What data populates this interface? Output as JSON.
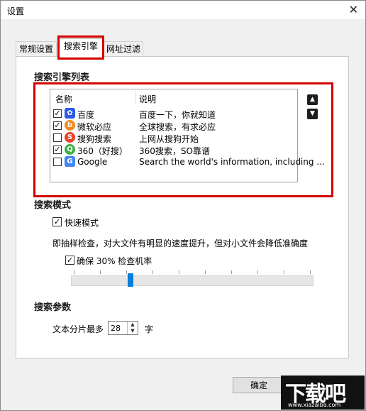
{
  "window": {
    "title": "设置",
    "close_glyph": "✕"
  },
  "tabs": [
    {
      "label": "常规设置",
      "active": false
    },
    {
      "label": "搜索引擎",
      "active": true
    },
    {
      "label": "网址过滤",
      "active": false
    }
  ],
  "engine_section": {
    "title": "搜索引擎列表",
    "columns": {
      "name": "名称",
      "desc": "说明"
    },
    "engines": [
      {
        "checked": true,
        "name": "百度",
        "desc": "百度一下，你就知道",
        "icon": "baidu-icon",
        "icon_glyph": "✿",
        "color": "#2d5be3"
      },
      {
        "checked": true,
        "name": "微软必应",
        "desc": "全球搜索，有求必应",
        "icon": "bing-icon",
        "icon_glyph": "b",
        "color": "#f28a1e"
      },
      {
        "checked": false,
        "name": "搜狗搜索",
        "desc": "上网从搜狗开始",
        "icon": "sogou-icon",
        "icon_glyph": "S",
        "color": "#e8432c"
      },
      {
        "checked": true,
        "name": "360（好搜）",
        "desc": "360搜索，SO靠谱",
        "icon": "360-icon",
        "icon_glyph": "Q",
        "color": "#3cb04b"
      },
      {
        "checked": false,
        "name": "Google",
        "desc": "Search the world's information, including ...",
        "icon": "google-icon",
        "icon_glyph": "G",
        "color": "#4285f4"
      }
    ],
    "move_up_glyph": "▲",
    "move_down_glyph": "▼"
  },
  "mode_section": {
    "title": "搜索模式",
    "fast_mode_label": "快速模式",
    "fast_mode_checked": true,
    "sampling_note": "即抽样检查，对大文件有明显的速度提升，但对小文件会降低准确度",
    "ensure_label": "确保 30% 检查机率",
    "ensure_checked": true,
    "slider_value_percent": 30
  },
  "param_section": {
    "title": "搜索参数",
    "chunk_prefix": "文本分片最多",
    "chunk_value": "28",
    "chunk_unit": "字"
  },
  "footer": {
    "ok_label": "确定"
  },
  "watermark": {
    "text": "下载吧",
    "url": "www.xiazaiba.com"
  },
  "colors": {
    "highlight_box": "#d40000",
    "slider_thumb": "#0a7ed8"
  }
}
